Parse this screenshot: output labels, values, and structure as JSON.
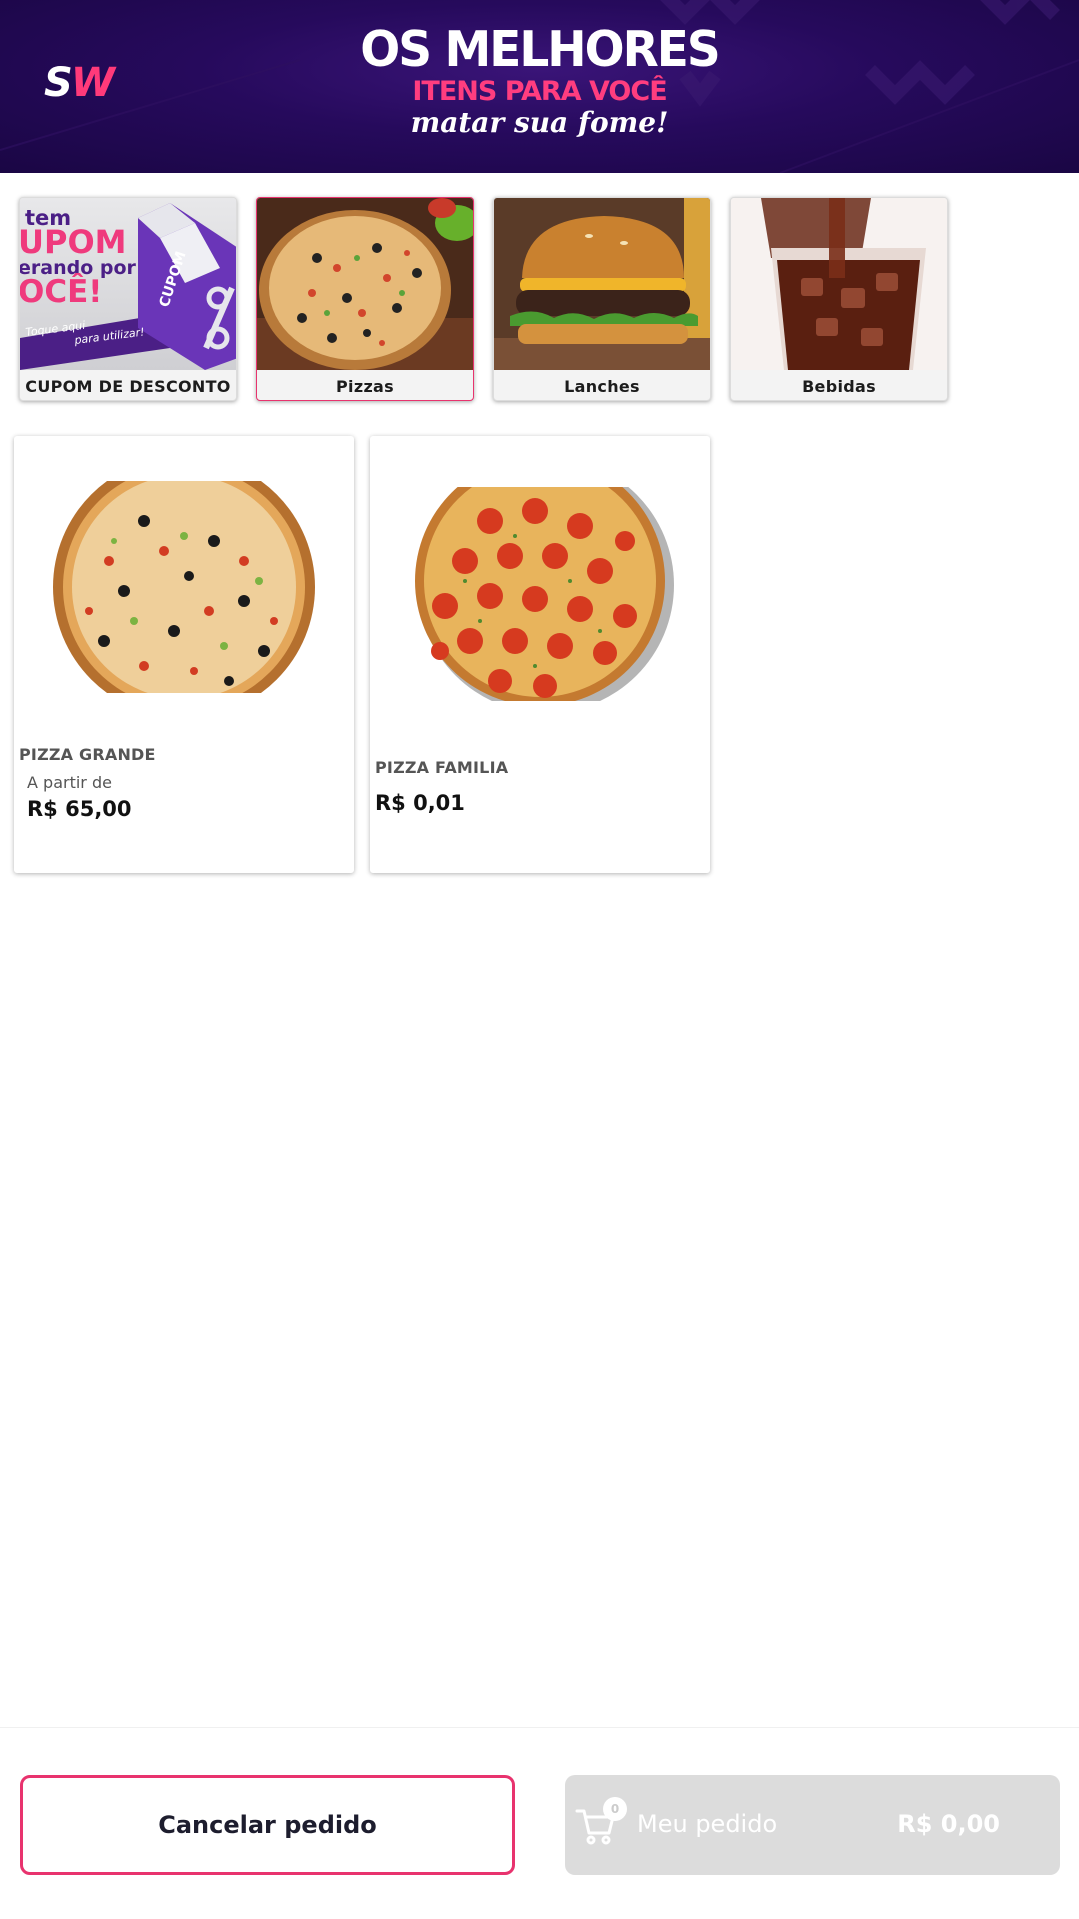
{
  "banner": {
    "logo_s": "S",
    "logo_w": "W",
    "line1": "OS MELHORES",
    "line2": "ITENS PARA VOCÊ",
    "line3": "matar sua fome!"
  },
  "categories": [
    {
      "label": "CUPOM DE DESCONTO",
      "promo": {
        "line1": "tem",
        "line2": "UPOM",
        "line3": "erando por",
        "line4": "OCÊ!",
        "cta1": "Toque aqui",
        "cta2": "para utilizar!",
        "box_label": "CUPOM",
        "box_symbol": "%"
      }
    },
    {
      "label": "Pizzas"
    },
    {
      "label": "Lanches"
    },
    {
      "label": "Bebidas"
    }
  ],
  "products": [
    {
      "name": "PIZZA GRANDE",
      "from_label": "A partir de",
      "price": "R$ 65,00"
    },
    {
      "name": "PIZZA FAMILIA",
      "price": "R$ 0,01"
    }
  ],
  "bottom": {
    "cancel_label": "Cancelar pedido",
    "cart_count": "0",
    "order_label": "Meu pedido",
    "order_total": "R$ 0,00"
  },
  "colors": {
    "accent": "#e8336e",
    "banner_bg": "#260a5c",
    "order_button_bg": "#dcdcdc"
  },
  "icons": {
    "cart": "shopping-cart-icon"
  }
}
